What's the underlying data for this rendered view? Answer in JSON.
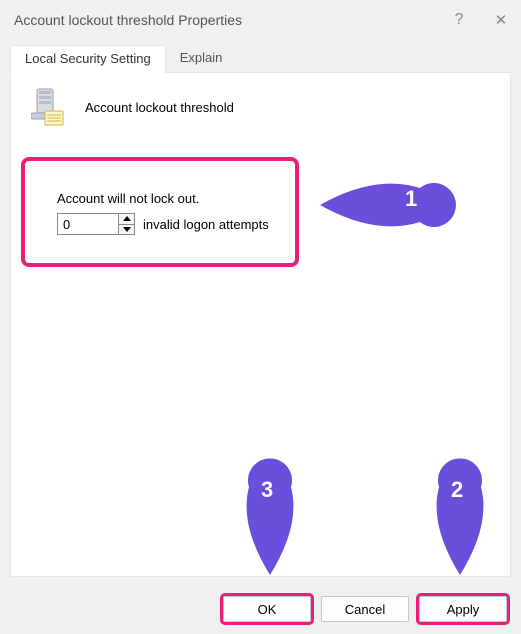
{
  "titlebar": {
    "title": "Account lockout threshold Properties",
    "help_symbol": "?",
    "close_symbol": "✕"
  },
  "tabs": {
    "local_security": "Local Security Setting",
    "explain": "Explain"
  },
  "policy": {
    "title": "Account lockout threshold",
    "no_lockout_text": "Account will not lock out.",
    "value": "0",
    "suffix": "invalid logon attempts"
  },
  "annotations": {
    "one": "1",
    "two": "2",
    "three": "3",
    "color": "#6a4edc"
  },
  "buttons": {
    "ok": "OK",
    "cancel": "Cancel",
    "apply": "Apply"
  }
}
